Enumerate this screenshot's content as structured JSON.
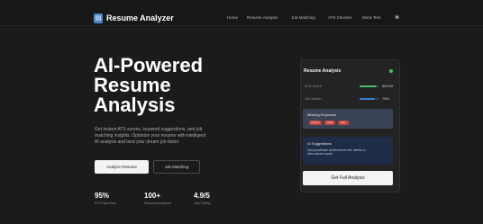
{
  "header": {
    "logo_glyph": "▤",
    "app_title": "Resume Analyzer",
    "nav": [
      "Home",
      "Resume Analysis",
      "Job Matching",
      "ATS Checker",
      "Mock Test"
    ],
    "theme_toggle_glyph": "☀",
    "theme_toggle_icon": "sun-icon"
  },
  "hero": {
    "title_lines": [
      "AI-Powered",
      "Resume",
      "Analysis"
    ],
    "description_lines": [
      "Get instant ATS scores, keyword suggestions, and job",
      "matching insights. Optimize your resume with intelligent",
      "AI analysis and land your dream job faster"
    ],
    "primary_button": "Analyze Resume",
    "secondary_button": "Job Matching"
  },
  "stats": [
    {
      "value": "95%",
      "label": "ATS Pass Rate"
    },
    {
      "value": "100+",
      "label": "Resumes Analyzed"
    },
    {
      "value": "4.9/5",
      "label": "User Rating"
    }
  ],
  "card": {
    "title": "Resume Analysis",
    "metrics": [
      {
        "label": "ATS Score",
        "value": "85/100",
        "fill": 0.85,
        "color": "#3ec46d"
      },
      {
        "label": "Job Match",
        "value": "75%",
        "fill": 0.75,
        "color": "#3f7fd8"
      }
    ],
    "missing_keywords": {
      "title": "Missing Keywords",
      "chips": [
        "Python",
        "AWS",
        "SQL"
      ]
    },
    "suggestions": {
      "title": "AI Suggestions",
      "lines": [
        "Add quantifiable achievements with metrics to",
        "demonstrate impact"
      ]
    },
    "button": "Get Full Analysis"
  },
  "colors": {
    "background": "#1b1b1b",
    "card": "#232323",
    "accent_green": "#3ec46d",
    "accent_blue": "#3f7fd8",
    "keyword_chip": "#c9453c"
  }
}
